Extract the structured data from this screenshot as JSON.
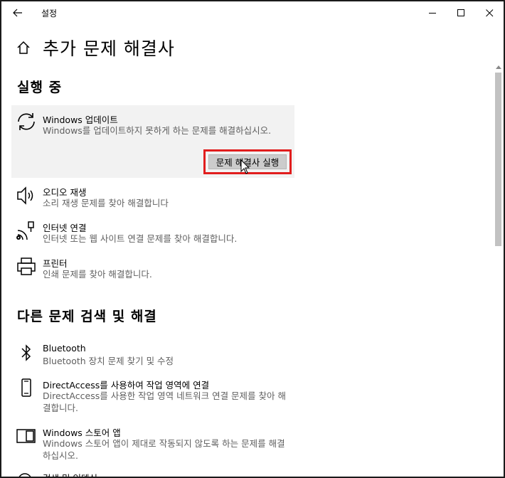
{
  "window": {
    "title": "설정",
    "back_icon": "back-arrow-icon",
    "minimize_icon": "minimize-icon",
    "maximize_icon": "maximize-icon",
    "close_icon": "close-icon"
  },
  "header": {
    "home_icon": "home-icon",
    "title": "추가 문제 해결사"
  },
  "sections": {
    "running": {
      "heading": "실행 중",
      "items": [
        {
          "icon": "refresh-icon",
          "name": "Windows 업데이트",
          "desc": "Windows를 업데이트하지 못하게 하는 문제를 해결하십시오.",
          "button": "문제 해결사 실행",
          "expanded": true
        },
        {
          "icon": "speaker-icon",
          "name": "오디오 재생",
          "desc": "소리 재생 문제를 찾아 해결합니다"
        },
        {
          "icon": "network-icon",
          "name": "인터넷 연결",
          "desc": "인터넷 또는 웹 사이트 연결 문제를 찾아 해결합니다."
        },
        {
          "icon": "printer-icon",
          "name": "프린터",
          "desc": "인쇄 문제를 찾아 해결합니다."
        }
      ]
    },
    "other": {
      "heading": "다른 문제 검색 및 해결",
      "items": [
        {
          "icon": "bluetooth-icon",
          "name": "Bluetooth",
          "desc": "Bluetooth 장치 문제 찾기 및 수정"
        },
        {
          "icon": "phone-icon",
          "name": "DirectAccess를 사용하여 작업 영역에 연결",
          "desc": "DirectAccess를 사용한 작업 영역 네트워크 연결 문제를 찾아 해결합니다."
        },
        {
          "icon": "store-app-icon",
          "name": "Windows 스토어 앱",
          "desc": "Windows 스토어 앱이 제대로 작동되지 않도록 하는 문제를 해결하십시오."
        },
        {
          "icon": "search-icon",
          "name": "검색 및 인덱싱",
          "desc": ""
        }
      ]
    }
  },
  "colors": {
    "highlight_outline": "#e11d1d",
    "expanded_bg": "#f2f2f2",
    "desc_text": "#5f5f5f"
  }
}
